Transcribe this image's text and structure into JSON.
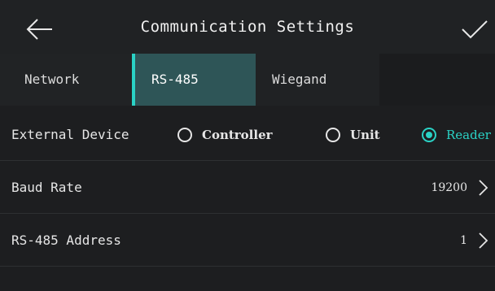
{
  "header": {
    "title": "Communication Settings",
    "back_icon": "arrow-left-icon",
    "confirm_icon": "checkmark-icon"
  },
  "tabs": [
    {
      "label": "Network",
      "active": false
    },
    {
      "label": "RS-485",
      "active": true
    },
    {
      "label": "Wiegand",
      "active": false
    }
  ],
  "external_device": {
    "label": "External Device",
    "options": [
      {
        "label": "Controller",
        "selected": false
      },
      {
        "label": "Unit",
        "selected": false
      },
      {
        "label": "Reader",
        "selected": true
      }
    ]
  },
  "baud_rate": {
    "label": "Baud Rate",
    "value": "19200"
  },
  "rs485_address": {
    "label": "RS-485 Address",
    "value": "1"
  },
  "colors": {
    "accent": "#2ad2c5",
    "active_tab_bg": "#2e5557",
    "background": "#1d1e20"
  }
}
